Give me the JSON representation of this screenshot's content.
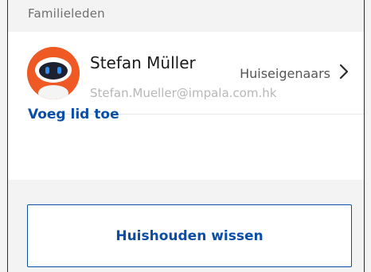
{
  "section": {
    "title": "Familieleden"
  },
  "member": {
    "name": "Stefan Müller",
    "email": "Stefan.Mueller@impala.com.hk",
    "role": "Huiseigenaars",
    "avatar_icon": "robot-avatar-icon",
    "avatar_color": "#ef5a24"
  },
  "actions": {
    "add_member_label": "Voeg lid toe",
    "clear_household_label": "Huishouden wissen"
  },
  "colors": {
    "accent": "#0a4ea8",
    "background": "#f3f3f4",
    "muted_text": "#b7b7b7"
  }
}
